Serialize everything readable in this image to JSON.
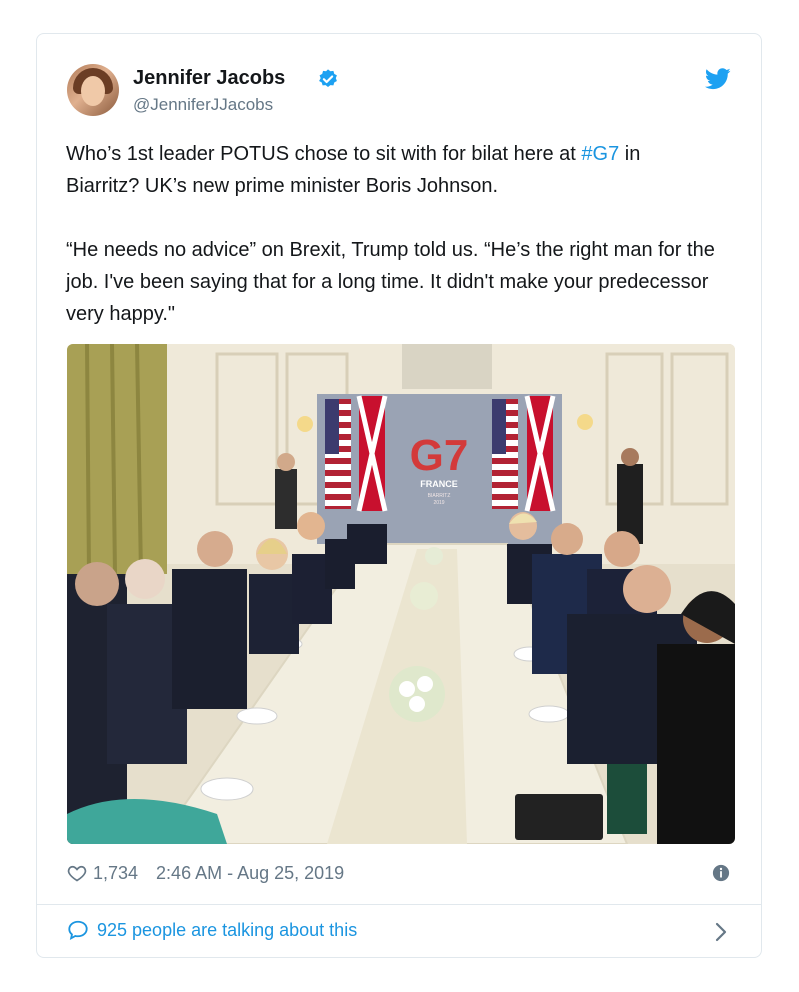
{
  "author": {
    "name": "Jennifer Jacobs",
    "handle": "@JenniferJJacobs"
  },
  "tweet": {
    "line1_pre": "Who’s 1st leader POTUS chose to sit with for bilat here at ",
    "hashtag": "#G7",
    "line1_post": " in Biarritz? UK’s new prime minister Boris Johnson.",
    "paragraph2": "“He needs no advice” on Brexit, Trump told us. “He’s the right man for the job. I've been saying that for a long time. It didn't make your predecessor very happy.\""
  },
  "photo": {
    "backdrop_title": "G7",
    "backdrop_sub": "FRANCE",
    "backdrop_sub2": "BIARRITZ",
    "backdrop_year": "2019"
  },
  "stats": {
    "likes": "1,734",
    "timestamp": "2:46 AM - Aug 25, 2019"
  },
  "conversation": {
    "label": "925 people are talking about this"
  },
  "colors": {
    "accent": "#1b95e0",
    "muted": "#657786",
    "text": "#14171a"
  }
}
